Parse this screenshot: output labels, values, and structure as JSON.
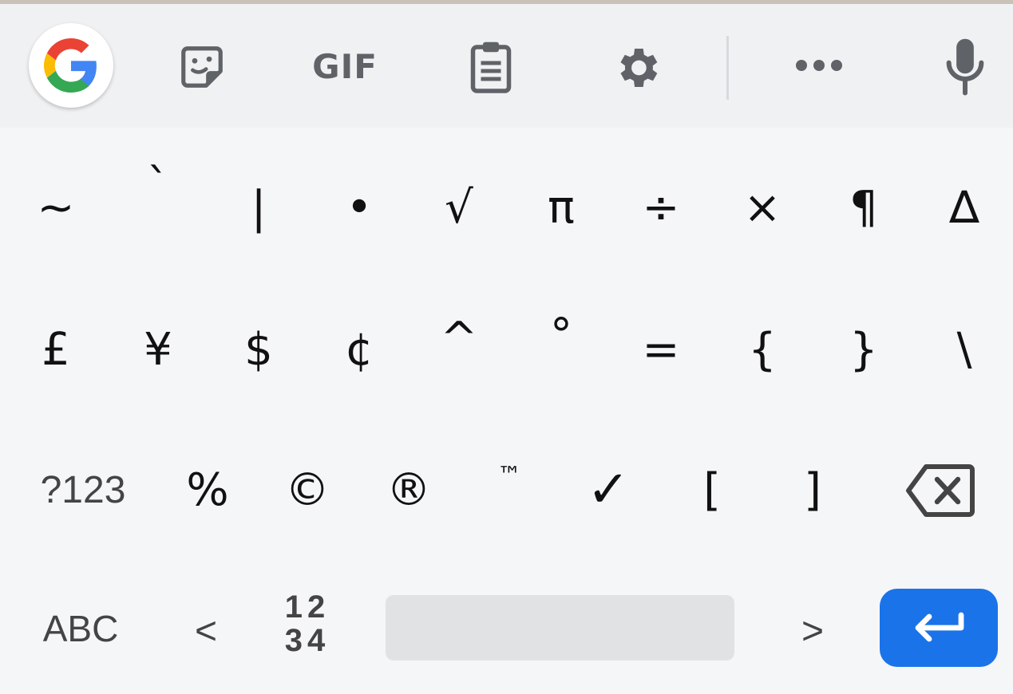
{
  "toolbar": {
    "gif_label": "GIF",
    "icons": [
      "google-icon",
      "sticker-icon",
      "clipboard-icon",
      "settings-gear-icon",
      "more-icon",
      "microphone-icon"
    ]
  },
  "rows": {
    "row1": [
      "~",
      "`",
      "|",
      "•",
      "√",
      "π",
      "÷",
      "×",
      "¶",
      "∆"
    ],
    "row2": [
      "£",
      "¥",
      "$",
      "¢",
      "^",
      "°",
      "=",
      "{",
      "}",
      "\\"
    ],
    "row3": {
      "mode_key": "?123",
      "keys": [
        "%",
        "©",
        "®",
        "™",
        "✓",
        "[",
        "]"
      ]
    },
    "row4": {
      "abc_key": "ABC",
      "less_than": "<",
      "numpad_line1": "12",
      "numpad_line2": "34",
      "greater_than": ">"
    }
  },
  "colors": {
    "toolbar_bg": "#f0f1f3",
    "keyboard_bg": "#f5f6f8",
    "enter_bg": "#1a73e8",
    "icon_gray": "#5f6368",
    "spacebar": "#e1e2e4"
  }
}
